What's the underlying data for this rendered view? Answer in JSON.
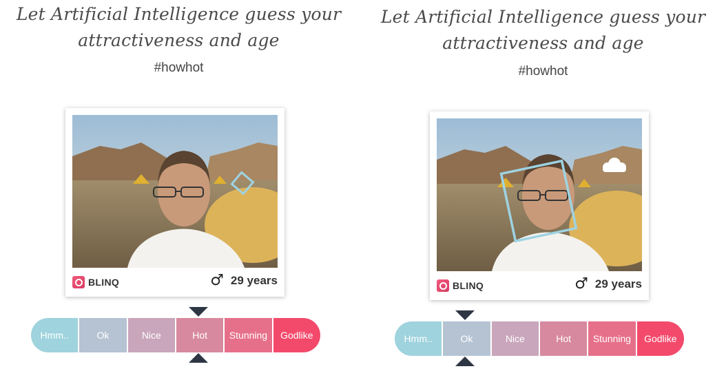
{
  "left_panel": {
    "headline": "Let Artificial Intelligence guess your attractiveness and age",
    "hashtag": "#howhot",
    "card": {
      "brand": "BLINQ",
      "gender_icon": "male-symbol-icon",
      "gender_symbol": "♂",
      "age": "29 years"
    },
    "scale": {
      "labels": [
        "Hmm..",
        "Ok",
        "Nice",
        "Hot",
        "Stunning",
        "Godlike"
      ],
      "selected": "Hot"
    }
  },
  "right_panel": {
    "headline": "Let Artificial Intelligence guess your attractiveness and age",
    "hashtag": "#howhot",
    "card": {
      "brand": "BLINQ",
      "gender_icon": "male-symbol-icon",
      "gender_symbol": "♂",
      "age": "29 years"
    },
    "scale": {
      "labels": [
        "Hmm..",
        "Ok",
        "Nice",
        "Hot",
        "Stunning",
        "Godlike"
      ],
      "selected": "Ok"
    }
  },
  "colors": {
    "scale": [
      "#9fd3dd",
      "#b5c3d3",
      "#c9a6bb",
      "#d7899f",
      "#e6708a",
      "#f34a6c"
    ],
    "pointer": "#2e3644",
    "face_box": "#9ed3e2"
  }
}
